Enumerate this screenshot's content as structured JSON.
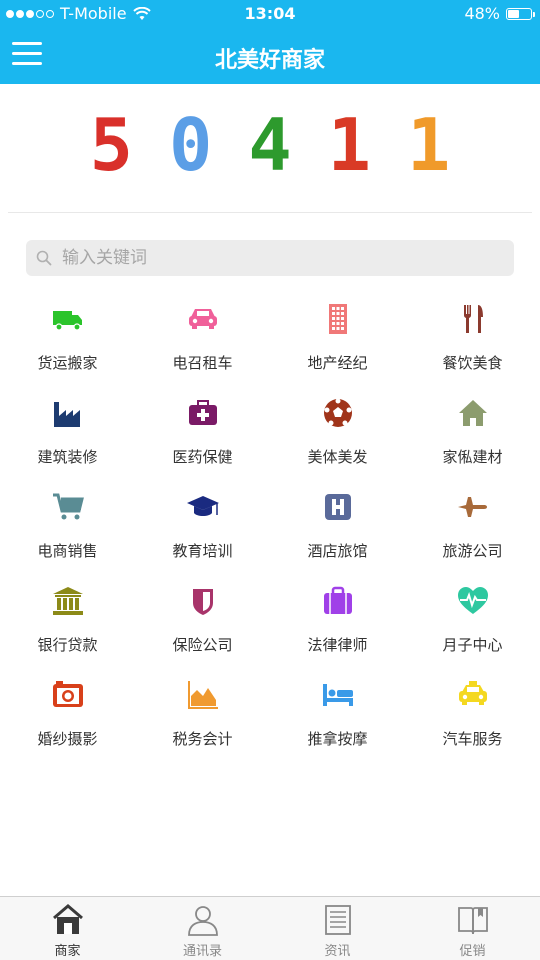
{
  "status_bar": {
    "carrier": "T-Mobile",
    "time": "13:04",
    "battery": "48%",
    "battery_level": 0.48
  },
  "nav": {
    "title": "北美好商家"
  },
  "counter": {
    "digits": [
      {
        "value": "5",
        "color": "#d9302a"
      },
      {
        "value": "0",
        "color": "#5b9ee6"
      },
      {
        "value": "4",
        "color": "#2d9a2d"
      },
      {
        "value": "1",
        "color": "#d93a26"
      },
      {
        "value": "1",
        "color": "#f09a2a"
      }
    ]
  },
  "search": {
    "placeholder": "输入关键词"
  },
  "categories": [
    {
      "label": "货运搬家",
      "icon": "truck-icon",
      "color": "#2bc42b"
    },
    {
      "label": "电召租车",
      "icon": "car-icon",
      "color": "#f0609a"
    },
    {
      "label": "地产经纪",
      "icon": "building-icon",
      "color": "#f07878"
    },
    {
      "label": "餐饮美食",
      "icon": "fork-knife-icon",
      "color": "#8b3a2e"
    },
    {
      "label": "建筑装修",
      "icon": "factory-icon",
      "color": "#1d3b70"
    },
    {
      "label": "医药保健",
      "icon": "medical-kit-icon",
      "color": "#7a1a66"
    },
    {
      "label": "美体美发",
      "icon": "soccer-ball-icon",
      "color": "#a0341a"
    },
    {
      "label": "家俬建材",
      "icon": "home-icon",
      "color": "#8c9c6e"
    },
    {
      "label": "电商销售",
      "icon": "shopping-cart-icon",
      "color": "#5a8c94"
    },
    {
      "label": "教育培训",
      "icon": "graduation-cap-icon",
      "color": "#1a2a80"
    },
    {
      "label": "酒店旅馆",
      "icon": "hotel-icon",
      "color": "#5a6a9a"
    },
    {
      "label": "旅游公司",
      "icon": "airplane-icon",
      "color": "#a86a3a"
    },
    {
      "label": "银行贷款",
      "icon": "bank-icon",
      "color": "#8c8a18"
    },
    {
      "label": "保险公司",
      "icon": "shield-icon",
      "color": "#a8346a"
    },
    {
      "label": "法律律师",
      "icon": "briefcase-icon",
      "color": "#a040e8"
    },
    {
      "label": "月子中心",
      "icon": "heartbeat-icon",
      "color": "#2ec8a0"
    },
    {
      "label": "婚纱摄影",
      "icon": "camera-icon",
      "color": "#d8401a"
    },
    {
      "label": "税务会计",
      "icon": "area-chart-icon",
      "color": "#f09a30"
    },
    {
      "label": "推拿按摩",
      "icon": "bed-icon",
      "color": "#3a9ae8"
    },
    {
      "label": "汽车服务",
      "icon": "taxi-icon",
      "color": "#f4d820"
    }
  ],
  "tabs": [
    {
      "label": "商家",
      "icon": "store-icon",
      "active": true
    },
    {
      "label": "通讯录",
      "icon": "person-icon",
      "active": false
    },
    {
      "label": "资讯",
      "icon": "news-icon",
      "active": false
    },
    {
      "label": "促销",
      "icon": "book-icon",
      "active": false
    }
  ]
}
